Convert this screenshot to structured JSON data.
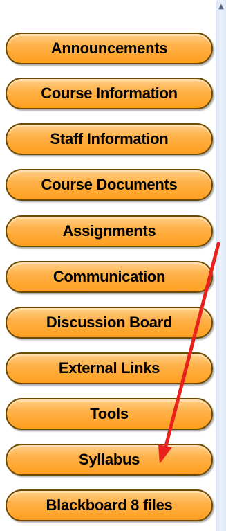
{
  "nav": {
    "items": [
      {
        "label": "Announcements"
      },
      {
        "label": "Course Information"
      },
      {
        "label": "Staff Information"
      },
      {
        "label": "Course Documents"
      },
      {
        "label": "Assignments"
      },
      {
        "label": "Communication"
      },
      {
        "label": "Discussion Board"
      },
      {
        "label": "External Links"
      },
      {
        "label": "Tools"
      },
      {
        "label": "Syllabus"
      },
      {
        "label": "Blackboard 8 files"
      }
    ]
  },
  "scrollbar": {
    "up_icon": "chevron-up-icon"
  },
  "annotation": {
    "icon": "red-arrow-icon",
    "color": "#e8211c"
  },
  "colors": {
    "button_fill": "#ffb24a",
    "button_border": "#6e4a00",
    "scrollbar": "#e8eef9"
  }
}
